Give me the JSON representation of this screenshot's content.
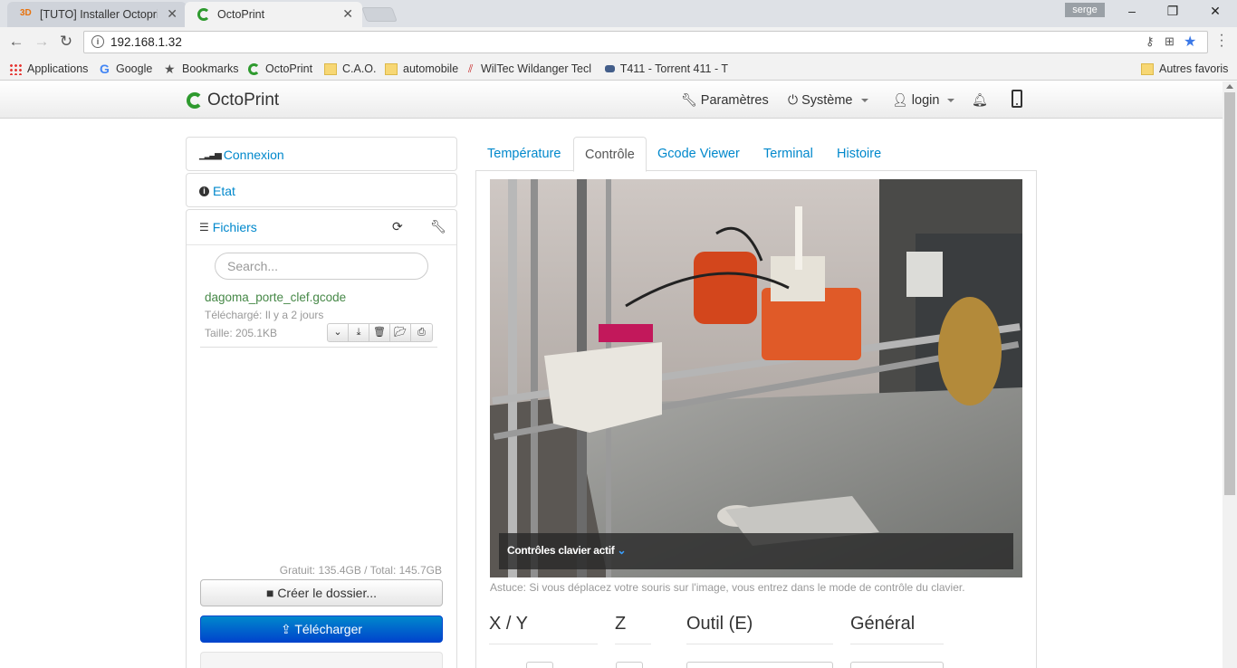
{
  "browser": {
    "tabs": [
      {
        "title": "[TUTO] Installer Octoprin",
        "favicon": "3D",
        "favicon_name": "3d-site-icon"
      },
      {
        "title": "OctoPrint",
        "favicon_name": "octoprint-icon"
      }
    ],
    "profile": "serge",
    "url": "192.168.1.32",
    "bookmarks": [
      {
        "label": "Applications",
        "icon": "apps-grid-icon"
      },
      {
        "label": "Google",
        "icon": "google-icon"
      },
      {
        "label": "Bookmarks",
        "icon": "star-icon"
      },
      {
        "label": "OctoPrint",
        "icon": "octoprint-icon"
      },
      {
        "label": "C.A.O.",
        "icon": "folder-icon"
      },
      {
        "label": "automobile",
        "icon": "folder-icon"
      },
      {
        "label": "WilTec Wildanger Tecl",
        "icon": "wiltec-icon"
      },
      {
        "label": "T411 - Torrent 411 - T",
        "icon": "t411-icon"
      }
    ],
    "other_bookmarks": "Autres favoris"
  },
  "octoprint": {
    "brand": "OctoPrint",
    "nav": {
      "settings": "Paramètres",
      "system": "Système",
      "login": "login"
    },
    "sidebar": {
      "connection": "Connexion",
      "state": "Etat",
      "files": "Fichiers",
      "search_placeholder": "Search...",
      "file": {
        "name": "dagoma_porte_clef.gcode",
        "uploaded": "Téléchargé: Il y a 2 jours",
        "size": "Taille: 205.1KB"
      },
      "space": "Gratuit: 135.4GB / Total: 145.7GB",
      "create_folder": "Créer le dossier...",
      "upload": "Télécharger"
    },
    "tabs": [
      "Température",
      "Contrôle",
      "Gcode Viewer",
      "Terminal",
      "Histoire"
    ],
    "active_tab": "Contrôle",
    "control": {
      "keyboard_label": "Contrôles clavier actif",
      "hint": "Astuce: Si vous déplacez votre souris sur l'image, vous entrez dans le mode de contrôle du clavier.",
      "headings": [
        "X / Y",
        "Z",
        "Outil (E)",
        "Général"
      ]
    }
  },
  "colors": {
    "link": "#0088cc",
    "file_name": "#468847",
    "primary_button": "#0055cc",
    "octoprint_green": "#2e9a2e"
  }
}
